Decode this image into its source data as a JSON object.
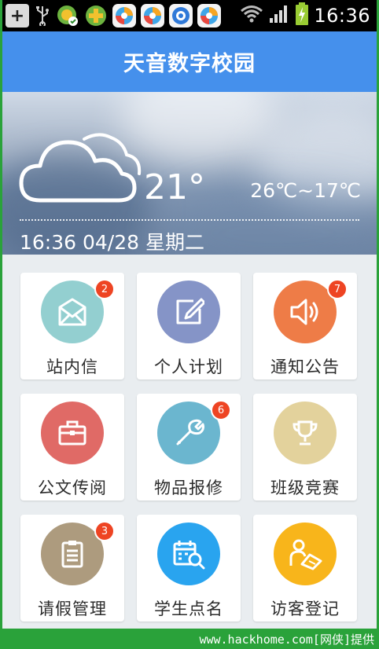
{
  "status_bar": {
    "time": "16:36"
  },
  "header": {
    "title": "天音数字校园"
  },
  "weather": {
    "current_temp": "21°",
    "temp_range": "26℃~17℃",
    "datetime": "16:36 04/28 星期二"
  },
  "tiles": [
    {
      "label": "站内信",
      "badge": "2",
      "icon": "envelope-icon",
      "color": "#93cfd0"
    },
    {
      "label": "个人计划",
      "badge": "",
      "icon": "edit-icon",
      "color": "#8594c7"
    },
    {
      "label": "通知公告",
      "badge": "7",
      "icon": "speaker-icon",
      "color": "#ee7c47"
    },
    {
      "label": "公文传阅",
      "badge": "",
      "icon": "briefcase-icon",
      "color": "#e06a66"
    },
    {
      "label": "物品报修",
      "badge": "6",
      "icon": "wrench-icon",
      "color": "#6bb6cf"
    },
    {
      "label": "班级竞赛",
      "badge": "",
      "icon": "trophy-icon",
      "color": "#e3d29c"
    },
    {
      "label": "请假管理",
      "badge": "3",
      "icon": "clipboard-icon",
      "color": "#ad9b7e"
    },
    {
      "label": "学生点名",
      "badge": "",
      "icon": "calendar-search-icon",
      "color": "#29a4ef"
    },
    {
      "label": "访客登记",
      "badge": "",
      "icon": "visitor-sign-icon",
      "color": "#f8b51b"
    }
  ],
  "footer": {
    "text": "www.hackhome.com[网侠]提供"
  }
}
